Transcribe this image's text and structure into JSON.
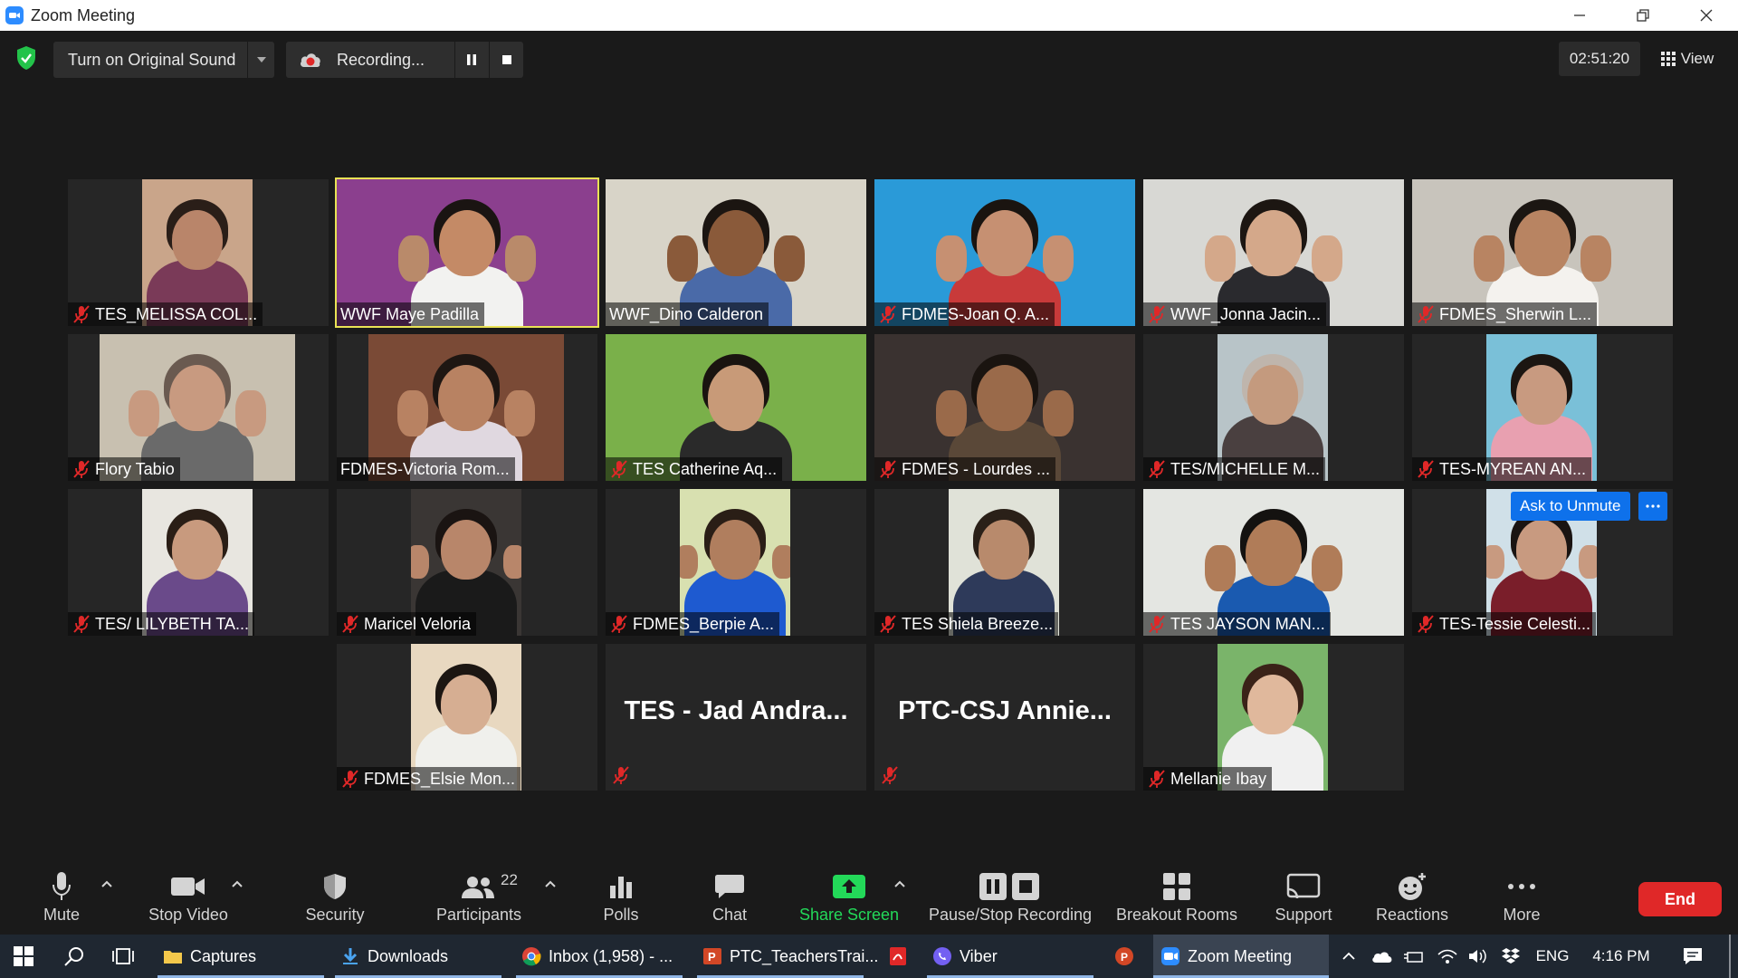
{
  "window": {
    "title": "Zoom Meeting"
  },
  "topbar": {
    "original_sound_label": "Turn on Original Sound",
    "recording_label": "Recording...",
    "timer": "02:51:20",
    "view_label": "View"
  },
  "participants_grid": [
    {
      "name": "TES_MELISSA COL...",
      "muted": true,
      "speaking": false
    },
    {
      "name": "WWF Maye Padilla",
      "muted": false,
      "speaking": true
    },
    {
      "name": "WWF_Dino Calderon",
      "muted": false,
      "speaking": false
    },
    {
      "name": "FDMES-Joan Q. A...",
      "muted": true,
      "speaking": false
    },
    {
      "name": "WWF_Jonna Jacin...",
      "muted": true,
      "speaking": false
    },
    {
      "name": "FDMES_Sherwin L...",
      "muted": true,
      "speaking": false
    },
    {
      "name": "Flory Tabio",
      "muted": true,
      "speaking": false
    },
    {
      "name": "FDMES-Victoria Rom...",
      "muted": false,
      "speaking": false
    },
    {
      "name": "TES Catherine Aq...",
      "muted": true,
      "speaking": false
    },
    {
      "name": "FDMES - Lourdes ...",
      "muted": true,
      "speaking": false
    },
    {
      "name": "TES/MICHELLE M...",
      "muted": true,
      "speaking": false
    },
    {
      "name": "TES-MYREAN AN...",
      "muted": true,
      "speaking": false
    },
    {
      "name": "TES/  LILYBETH TA...",
      "muted": true,
      "speaking": false
    },
    {
      "name": "Maricel Veloria",
      "muted": true,
      "speaking": false
    },
    {
      "name": "FDMES_Berpie A...",
      "muted": true,
      "speaking": false
    },
    {
      "name": "TES Shiela Breeze...",
      "muted": true,
      "speaking": false
    },
    {
      "name": "TES JAYSON MAN...",
      "muted": true,
      "speaking": false
    },
    {
      "name": "TES-Tessie Celesti...",
      "muted": true,
      "speaking": false
    },
    {
      "name": "FDMES_Elsie Mon...",
      "muted": true,
      "speaking": false
    },
    {
      "name": "TES  -  Jad  Andra...",
      "muted": true,
      "speaking": false,
      "video_off": true
    },
    {
      "name": "PTC-CSJ  Annie...",
      "muted": true,
      "speaking": false,
      "video_off": true
    },
    {
      "name": "Mellanie Ibay",
      "muted": true,
      "speaking": false
    }
  ],
  "hover_actions": {
    "ask_to_unmute": "Ask to Unmute",
    "more": "..."
  },
  "toolbar": {
    "mute": "Mute",
    "stop_video": "Stop Video",
    "security": "Security",
    "participants": "Participants",
    "participants_count": "22",
    "polls": "Polls",
    "chat": "Chat",
    "share_screen": "Share Screen",
    "pause_stop_recording": "Pause/Stop Recording",
    "breakout_rooms": "Breakout Rooms",
    "support": "Support",
    "reactions": "Reactions",
    "more": "More",
    "end": "End"
  },
  "taskbar": {
    "items": [
      {
        "label": "Captures",
        "icon": "folder-icon"
      },
      {
        "label": "Downloads",
        "icon": "download-icon"
      },
      {
        "label": "Inbox (1,958) - ...",
        "icon": "chrome-icon"
      },
      {
        "label": "PTC_TeachersTrai...",
        "icon": "powerpoint-icon"
      },
      {
        "label": "Viber",
        "icon": "viber-icon"
      },
      {
        "label": "Zoom Meeting",
        "icon": "zoom-icon"
      }
    ],
    "language": "ENG",
    "time": "4:16 PM"
  },
  "colors": {
    "accent_blue": "#0e71eb",
    "speaking_border": "#e9e255",
    "muted_red": "#e02828",
    "share_green": "#23d959",
    "end_red": "#e02828"
  }
}
